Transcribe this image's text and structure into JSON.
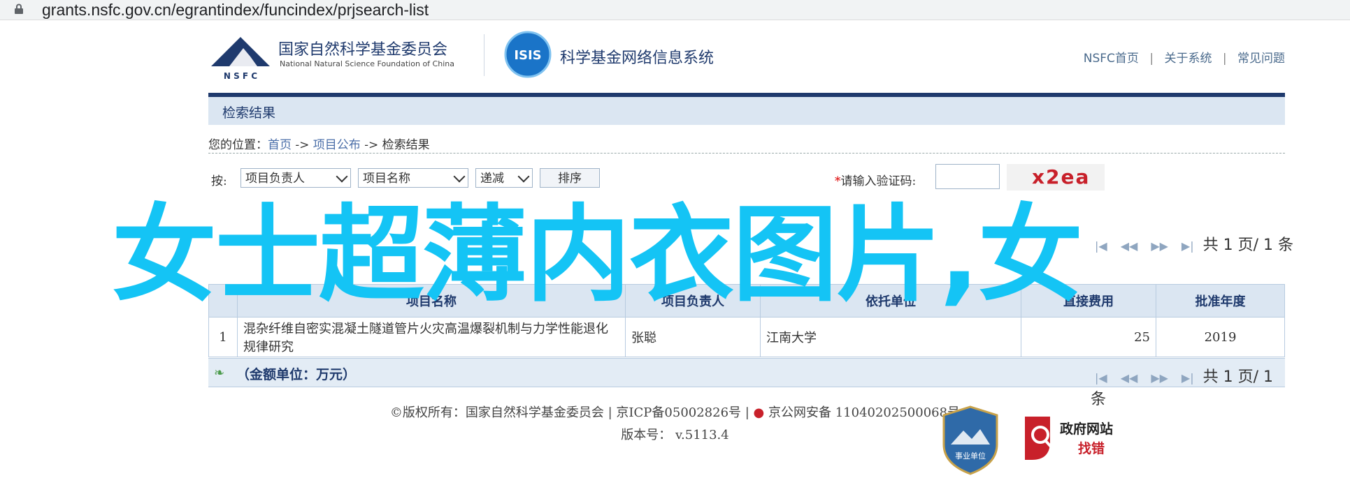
{
  "browser": {
    "url": "grants.nsfc.gov.cn/egrantindex/funcindex/prjsearch-list"
  },
  "header": {
    "nsfc_logo_text": "N S F C",
    "nsfc_name_cn": "国家自然科学基金委员会",
    "nsfc_name_en": "National Natural Science Foundation of China",
    "isis_logo_text": "ISIS",
    "system_title": "科学基金网络信息系统",
    "links": [
      "NSFC首页",
      "关于系统",
      "常见问题"
    ]
  },
  "panel": {
    "title": "检索结果"
  },
  "breadcrumb": {
    "prefix": "您的位置：",
    "items": [
      "首页",
      "项目公布",
      "检索结果"
    ],
    "sep": " -> "
  },
  "search": {
    "sort_by_label": "按:",
    "sort_field_1": "项目负责人",
    "sort_field_2": "项目名称",
    "order": "递减",
    "sort_button": "排序",
    "captcha_star": "*",
    "captcha_label": "请输入验证码:",
    "captcha_value": "",
    "captcha_image_text": "x2ea"
  },
  "pager": {
    "first": "|◀",
    "prev": "◀◀",
    "next": "▶▶",
    "last": "▶|",
    "total_pages": "共 1 页/ 1 条"
  },
  "table": {
    "headers": [
      "",
      "项目名称",
      "项目负责人",
      "依托单位",
      "直接费用",
      "批准年度"
    ],
    "rows": [
      {
        "index": "1",
        "title": "混杂纤维自密实混凝土隧道管片火灾高温爆裂机制与力学性能退化规律研究",
        "leader": "张聪",
        "institution": "江南大学",
        "funding": "25",
        "year": "2019"
      }
    ]
  },
  "footbar": {
    "unit": "（金额单位：万元）"
  },
  "footer": {
    "copyright": "©版权所有：国家自然科学基金委员会 | 京ICP备05002826号 | ",
    "police": "京公网安备 11040202500068号",
    "version_label": "版本号：",
    "version": "v.5113.4",
    "emblem_text": "事业单位",
    "gov_logo_title": "政府网站",
    "gov_logo_sub": "找错"
  },
  "overlay": {
    "text": "女士超薄内衣图片,女"
  },
  "colors": {
    "brand": "#1f3a6d",
    "overlay": "#14c4f5",
    "panel_bg": "#dbe6f2",
    "link": "#4a6ea8"
  }
}
